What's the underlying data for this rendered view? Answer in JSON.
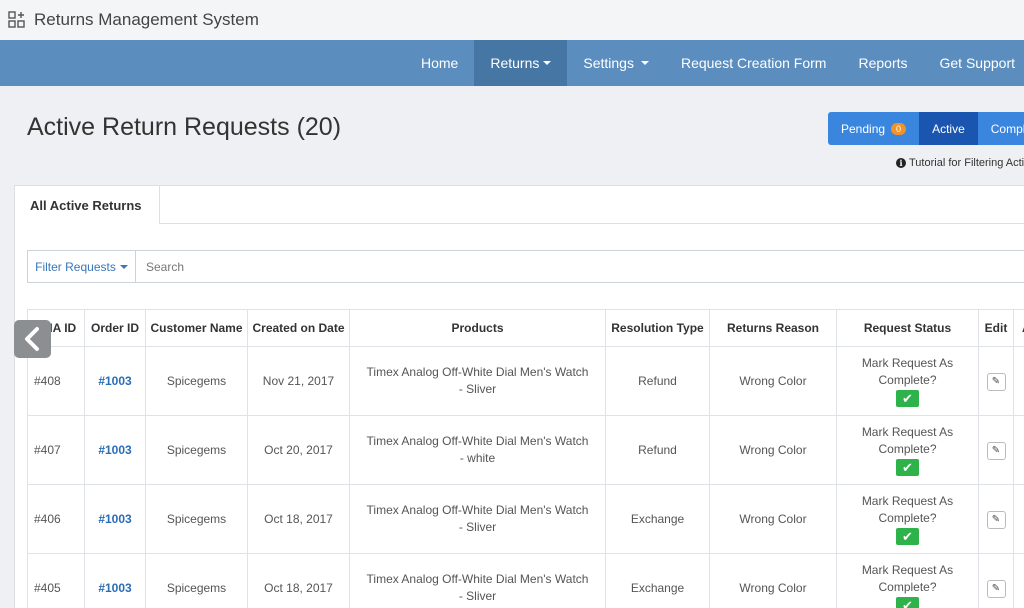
{
  "app": {
    "title": "Returns Management System",
    "icon": "apps-plus-icon"
  },
  "nav": {
    "items": [
      {
        "label": "Home",
        "dropdown": false,
        "active": false
      },
      {
        "label": "Returns",
        "dropdown": true,
        "active": true
      },
      {
        "label": "Settings",
        "dropdown": true,
        "active": false
      },
      {
        "label": "Request Creation Form",
        "dropdown": false,
        "active": false
      },
      {
        "label": "Reports",
        "dropdown": false,
        "active": false
      },
      {
        "label": "Get Support",
        "dropdown": false,
        "active": false
      }
    ]
  },
  "page": {
    "title": "Active Return Requests (20)"
  },
  "status_tabs": {
    "pending_label": "Pending",
    "pending_count": "0",
    "active_label": "Active",
    "complete_label": "Compl"
  },
  "tutorial": {
    "text": "Tutorial for Filtering Acti"
  },
  "card": {
    "tab_label": "All Active Returns"
  },
  "filter": {
    "button_label": "Filter Requests",
    "search_placeholder": "Search"
  },
  "table": {
    "headers": [
      "RMA ID",
      "Order ID",
      "Customer Name",
      "Created on Date",
      "Products",
      "Resolution Type",
      "Returns Reason",
      "Request Status",
      "Edit",
      "A"
    ],
    "status_text": "Mark Request As Complete?",
    "rows": [
      {
        "rma": "#408",
        "order": "#1003",
        "customer": "Spicegems",
        "date": "Nov 21, 2017",
        "product": "Timex Analog Off-White Dial Men's Watch - Sliver",
        "resolution": "Refund",
        "reason": "Wrong Color"
      },
      {
        "rma": "#407",
        "order": "#1003",
        "customer": "Spicegems",
        "date": "Oct 20, 2017",
        "product": "Timex Analog Off-White Dial Men's Watch - white",
        "resolution": "Refund",
        "reason": "Wrong Color"
      },
      {
        "rma": "#406",
        "order": "#1003",
        "customer": "Spicegems",
        "date": "Oct 18, 2017",
        "product": "Timex Analog Off-White Dial Men's Watch - Sliver",
        "resolution": "Exchange",
        "reason": "Wrong Color"
      },
      {
        "rma": "#405",
        "order": "#1003",
        "customer": "Spicegems",
        "date": "Oct 18, 2017",
        "product": "Timex Analog Off-White Dial Men's Watch - Sliver",
        "resolution": "Exchange",
        "reason": "Wrong Color"
      }
    ]
  },
  "colors": {
    "nav_bg": "#5b8dbe",
    "nav_active": "#4676a4",
    "tab_active": "#1a56b0",
    "link": "#2a6db5",
    "success": "#2db34a",
    "badge": "#f0932b"
  }
}
